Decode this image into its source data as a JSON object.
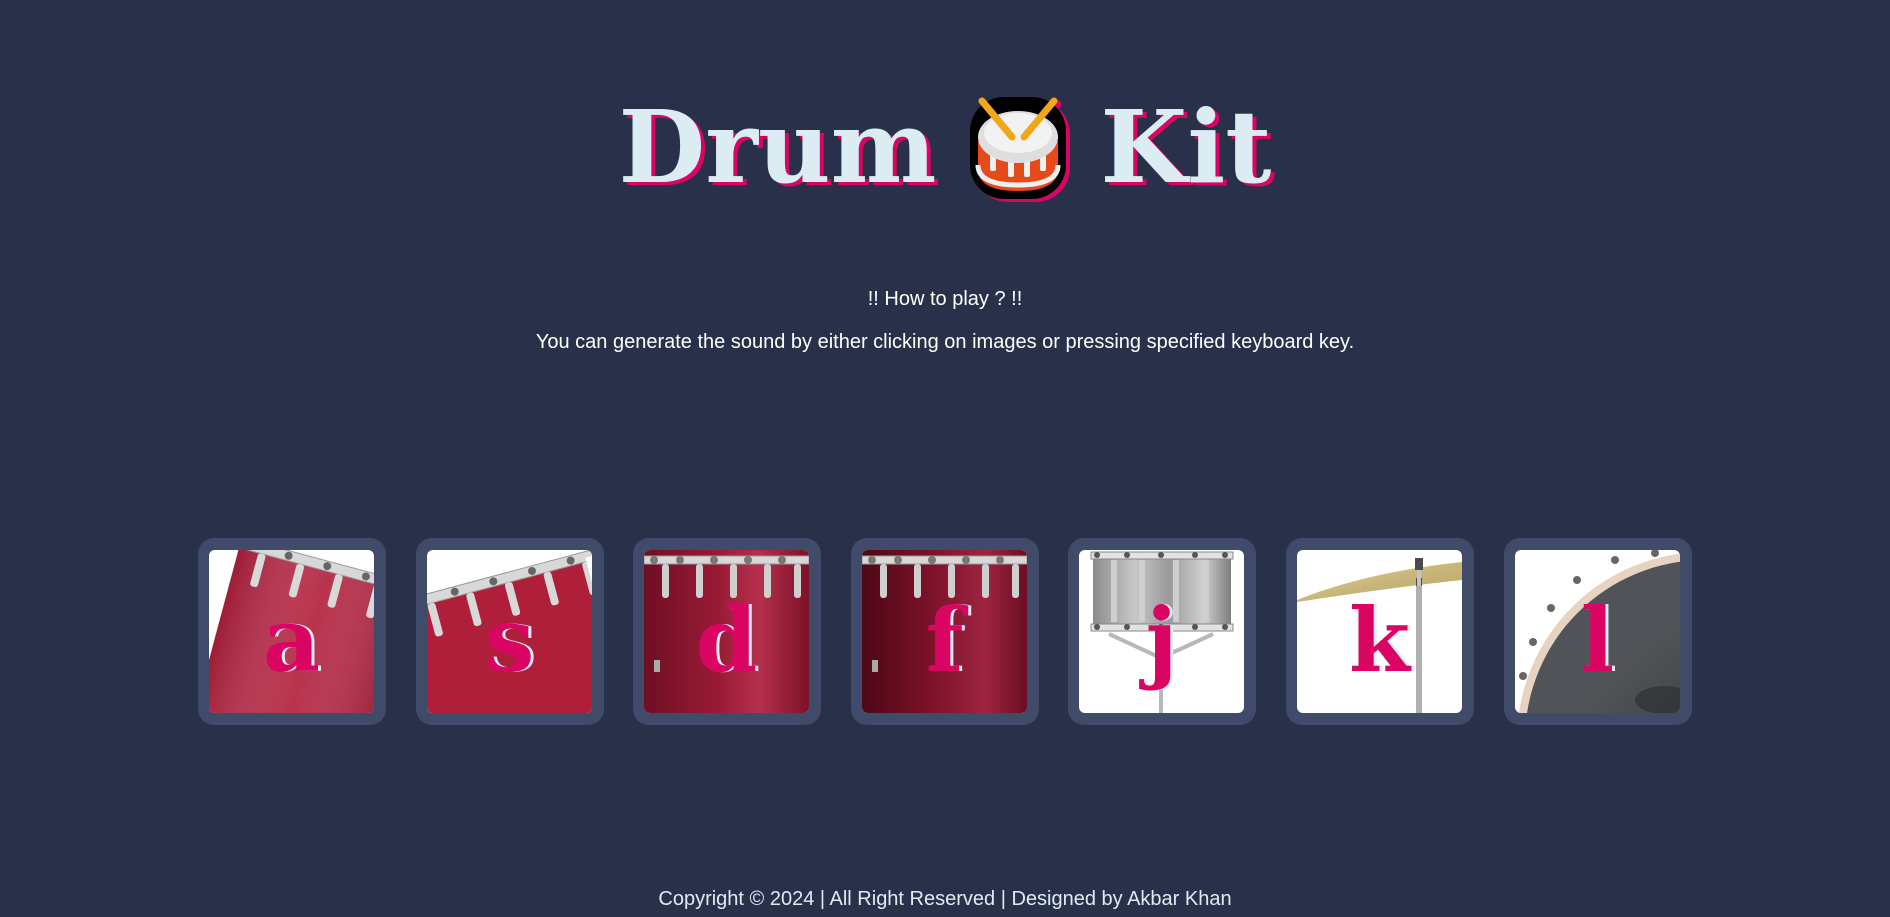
{
  "header": {
    "title_left": "Drum",
    "title_icon": "drum-emoji-icon",
    "title_right": "Kit"
  },
  "instructions": {
    "heading": "!! How to play ? !!",
    "text": "You can generate the sound by either clicking on images or pressing specified keyboard key."
  },
  "drums": [
    {
      "key": "a",
      "image": "tom-1-icon"
    },
    {
      "key": "s",
      "image": "tom-2-icon"
    },
    {
      "key": "d",
      "image": "tom-3-icon"
    },
    {
      "key": "f",
      "image": "tom-4-icon"
    },
    {
      "key": "j",
      "image": "snare-icon"
    },
    {
      "key": "k",
      "image": "crash-cymbal-icon"
    },
    {
      "key": "l",
      "image": "kick-drum-icon"
    }
  ],
  "footer": {
    "text": "Copyright © 2024 | All Right Reserved | Designed by Akbar Khan"
  },
  "colors": {
    "background": "#283149",
    "tile": "#404b69",
    "title": "#dbedf3",
    "accent": "#da0463"
  }
}
